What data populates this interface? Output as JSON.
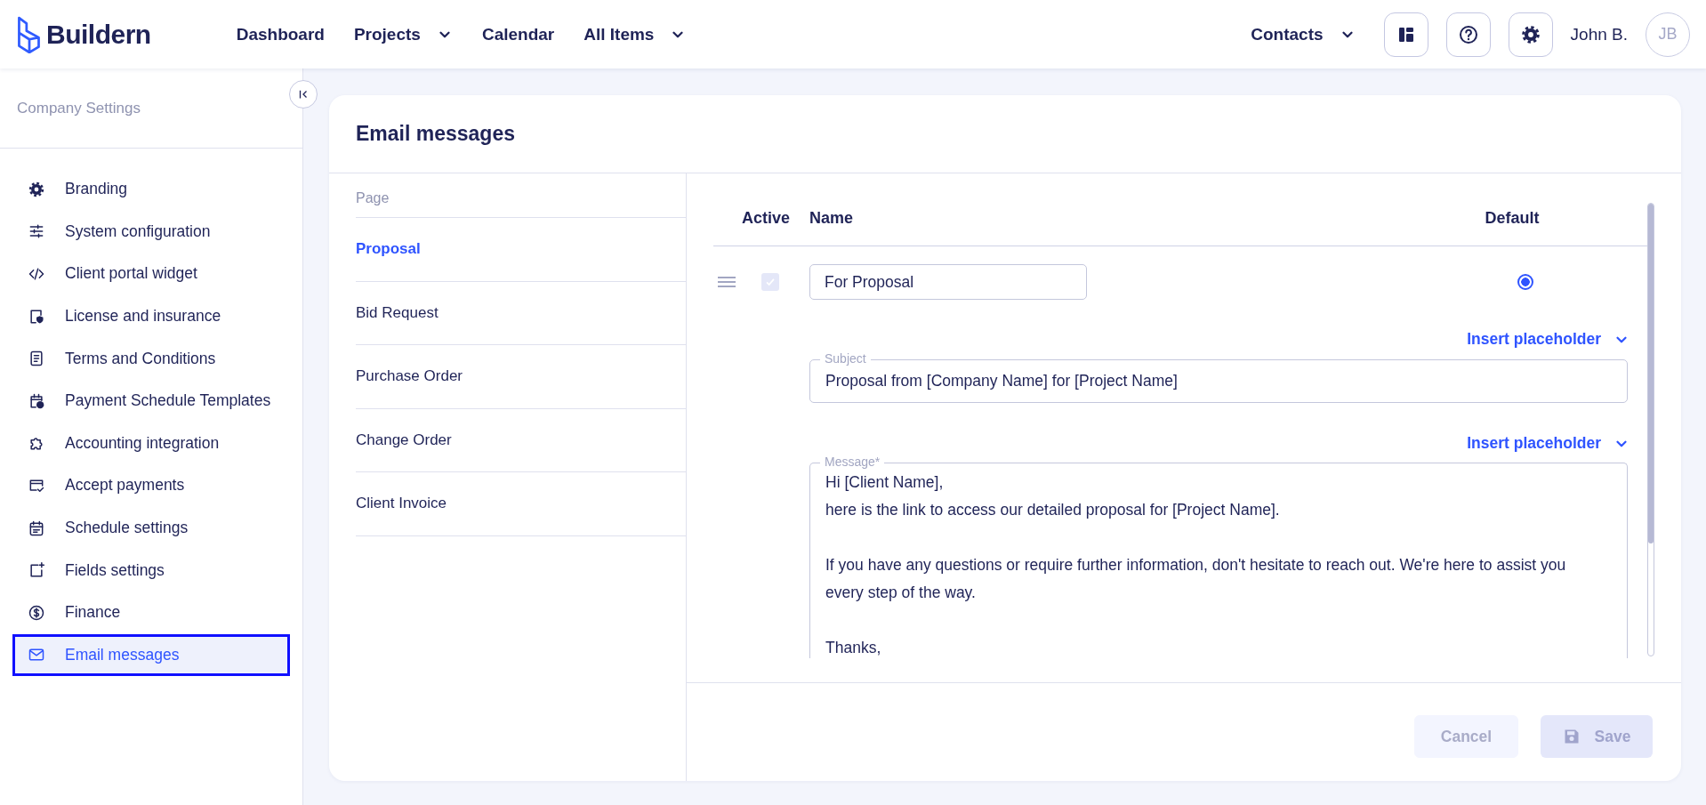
{
  "header": {
    "logo": "Buildern",
    "nav": [
      {
        "label": "Dashboard",
        "dropdown": false
      },
      {
        "label": "Projects",
        "dropdown": true
      },
      {
        "label": "Calendar",
        "dropdown": false
      },
      {
        "label": "All Items",
        "dropdown": true
      }
    ],
    "contacts": {
      "label": "Contacts",
      "dropdown": true
    },
    "user_name": "John B.",
    "avatar_initials": "JB"
  },
  "sidebar": {
    "title": "Company Settings",
    "items": [
      {
        "label": "Branding",
        "selected": false
      },
      {
        "label": "System configuration",
        "selected": false
      },
      {
        "label": "Client portal widget",
        "selected": false
      },
      {
        "label": "License and insurance",
        "selected": false
      },
      {
        "label": "Terms and Conditions",
        "selected": false
      },
      {
        "label": "Payment Schedule Templates",
        "selected": false
      },
      {
        "label": "Accounting integration",
        "selected": false
      },
      {
        "label": "Accept payments",
        "selected": false
      },
      {
        "label": "Schedule settings",
        "selected": false
      },
      {
        "label": "Fields settings",
        "selected": false
      },
      {
        "label": "Finance",
        "selected": false
      },
      {
        "label": "Email messages",
        "selected": true
      }
    ]
  },
  "card": {
    "title": "Email messages",
    "pages": {
      "heading": "Page",
      "items": [
        {
          "label": "Proposal",
          "selected": true
        },
        {
          "label": "Bid Request",
          "selected": false
        },
        {
          "label": "Purchase Order",
          "selected": false
        },
        {
          "label": "Change Order",
          "selected": false
        },
        {
          "label": "Client Invoice",
          "selected": false
        }
      ]
    },
    "table": {
      "columns": [
        "Active",
        "Name",
        "Default"
      ],
      "rows": [
        {
          "active": true,
          "active_disabled": true,
          "name": "For Proposal",
          "default": true,
          "subject_placeholder_link": "Insert placeholder",
          "subject_label": "Subject",
          "subject": "Proposal from [Company Name] for [Project Name]",
          "message_placeholder_link": "Insert placeholder",
          "message_label": "Message*",
          "message": "Hi [Client Name],\nhere is the link to access our detailed proposal for [Project Name].\n\nIf you have any questions or require further information, don't hesitate to reach out. We're here to assist you every step of the way.\n\nThanks,"
        }
      ]
    },
    "buttons": [
      {
        "label": "Cancel",
        "kind": "cancel",
        "disabled": true
      },
      {
        "label": "Save",
        "kind": "save",
        "disabled": true
      }
    ]
  }
}
